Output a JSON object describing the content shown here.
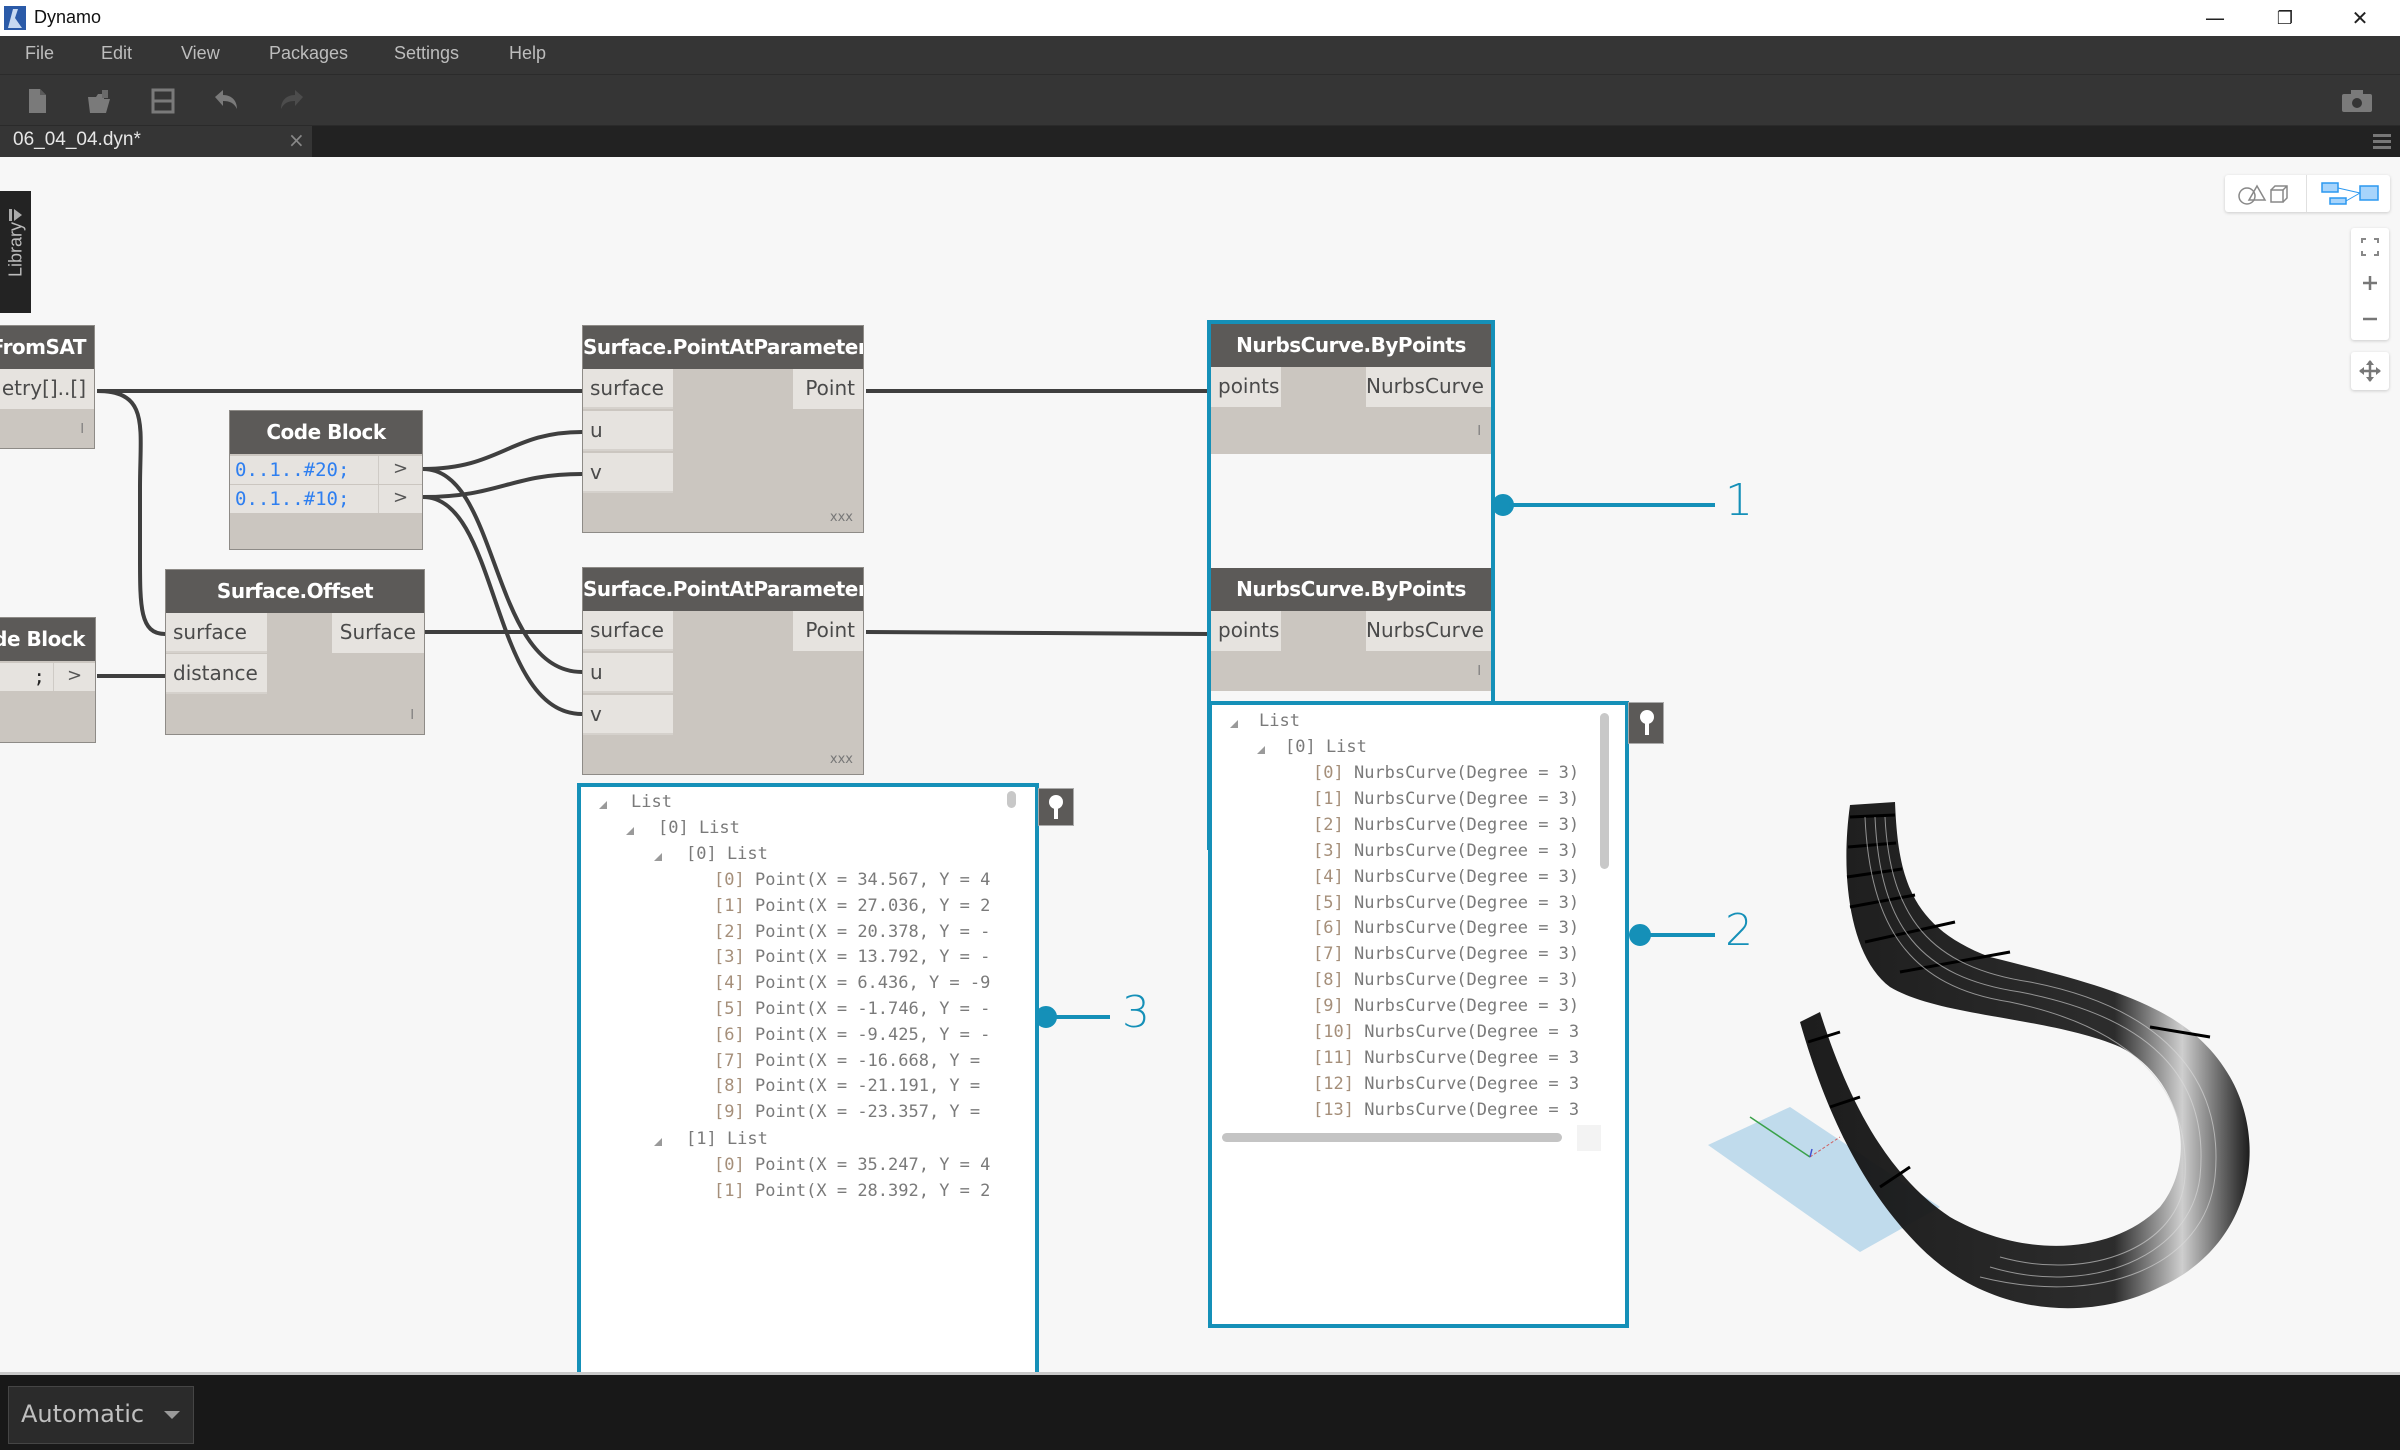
{
  "app": {
    "title": "Dynamo",
    "window_controls": {
      "minimize": "—",
      "restore": "❐",
      "close": "✕"
    }
  },
  "menu": [
    "File",
    "Edit",
    "View",
    "Packages",
    "Settings",
    "Help"
  ],
  "toolbar": {
    "icons": [
      "new-file-icon",
      "open-folder-icon",
      "save-icon",
      "undo-icon",
      "redo-icon"
    ],
    "right_icon": "camera-icon"
  },
  "tabs": [
    {
      "label": "06_04_04.dyn*",
      "close": "×",
      "active": true
    }
  ],
  "library": {
    "label": "Library"
  },
  "nodes": {
    "fromsat": {
      "title": "FromSAT",
      "output": "etry[]..[]",
      "footer": "l"
    },
    "code_block_top": {
      "title": "Code Block",
      "lines": [
        "0..1..#20;",
        "0..1..#10;"
      ],
      "out_port": ">"
    },
    "code_block_left": {
      "title": "ode Block",
      "line": ";",
      "out_port": ">"
    },
    "surface_offset": {
      "title": "Surface.Offset",
      "inputs": [
        "surface",
        "distance"
      ],
      "output": "Surface",
      "footer": "l"
    },
    "point_at_param_1": {
      "title": "Surface.PointAtParameter",
      "inputs": [
        "surface",
        "u",
        "v"
      ],
      "output": "Point",
      "footer": "xxx"
    },
    "point_at_param_2": {
      "title": "Surface.PointAtParameter",
      "inputs": [
        "surface",
        "u",
        "v"
      ],
      "output": "Point",
      "footer": "xxx"
    },
    "nurbs_1": {
      "title": "NurbsCurve.ByPoints",
      "input": "points",
      "output": "NurbsCurve",
      "footer": "l"
    },
    "nurbs_2": {
      "title": "NurbsCurve.ByPoints",
      "input": "points",
      "output": "NurbsCurve",
      "footer": "l"
    }
  },
  "watch_points": {
    "root": "List",
    "l1": "[0] List",
    "l2": "[0] List",
    "items": [
      {
        "idx": "[0]",
        "text": "Point(X = 34.567, Y = 4"
      },
      {
        "idx": "[1]",
        "text": "Point(X = 27.036, Y = 2"
      },
      {
        "idx": "[2]",
        "text": "Point(X = 20.378, Y = -"
      },
      {
        "idx": "[3]",
        "text": "Point(X = 13.792, Y = -"
      },
      {
        "idx": "[4]",
        "text": "Point(X = 6.436, Y = -9"
      },
      {
        "idx": "[5]",
        "text": "Point(X = -1.746, Y = -"
      },
      {
        "idx": "[6]",
        "text": "Point(X = -9.425, Y = -"
      },
      {
        "idx": "[7]",
        "text": "Point(X = -16.668, Y ="
      },
      {
        "idx": "[8]",
        "text": "Point(X = -21.191, Y ="
      },
      {
        "idx": "[9]",
        "text": "Point(X = -23.357, Y ="
      }
    ],
    "l2b": "[1] List",
    "items_b": [
      {
        "idx": "[0]",
        "text": "Point(X = 35.247, Y = 4"
      },
      {
        "idx": "[1]",
        "text": "Point(X = 28.392, Y = 2"
      }
    ]
  },
  "watch_curves": {
    "root": "List",
    "l1": "[0] List",
    "items": [
      {
        "idx": "[0]",
        "text": "NurbsCurve(Degree = 3)"
      },
      {
        "idx": "[1]",
        "text": "NurbsCurve(Degree = 3)"
      },
      {
        "idx": "[2]",
        "text": "NurbsCurve(Degree = 3)"
      },
      {
        "idx": "[3]",
        "text": "NurbsCurve(Degree = 3)"
      },
      {
        "idx": "[4]",
        "text": "NurbsCurve(Degree = 3)"
      },
      {
        "idx": "[5]",
        "text": "NurbsCurve(Degree = 3)"
      },
      {
        "idx": "[6]",
        "text": "NurbsCurve(Degree = 3)"
      },
      {
        "idx": "[7]",
        "text": "NurbsCurve(Degree = 3)"
      },
      {
        "idx": "[8]",
        "text": "NurbsCurve(Degree = 3)"
      },
      {
        "idx": "[9]",
        "text": "NurbsCurve(Degree = 3)"
      },
      {
        "idx": "[10]",
        "text": "NurbsCurve(Degree = 3"
      },
      {
        "idx": "[11]",
        "text": "NurbsCurve(Degree = 3"
      },
      {
        "idx": "[12]",
        "text": "NurbsCurve(Degree = 3"
      },
      {
        "idx": "[13]",
        "text": "NurbsCurve(Degree = 3"
      }
    ]
  },
  "callouts": [
    "1",
    "2",
    "3"
  ],
  "view_toggle": {
    "geometry": "geometry-view-icon",
    "graph": "graph-view-icon"
  },
  "nav": [
    "zoom-extents-icon",
    "zoom-in-icon",
    "zoom-out-icon",
    "pan-icon"
  ],
  "bottom": {
    "run_mode": "Automatic"
  },
  "colors": {
    "accent": "#1590b8",
    "node_header": "#5c5a58",
    "node_body": "#cbc6c0",
    "port": "#e6e3df",
    "code": "#2e7ff0"
  }
}
